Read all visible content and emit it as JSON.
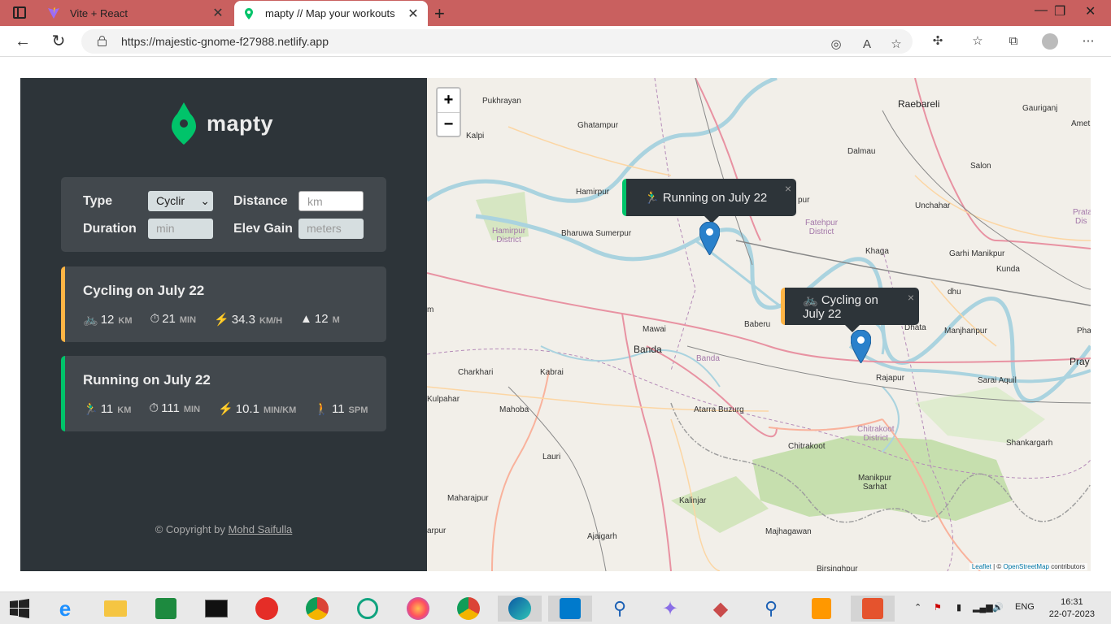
{
  "browser": {
    "tabs": [
      {
        "title": "Vite + React",
        "close": "✕",
        "active": false
      },
      {
        "title": "mapty // Map your workouts",
        "close": "✕",
        "active": true
      }
    ],
    "new_tab": "+",
    "window_controls": {
      "minimize": "—",
      "maximize": "❐",
      "close": "✕"
    },
    "url": "https://majestic-gnome-f27988.netlify.app"
  },
  "sidebar": {
    "logo": "mapty",
    "form": {
      "type_label": "Type",
      "type_value": "Cyclir",
      "distance_label": "Distance",
      "distance_placeholder": "km",
      "duration_label": "Duration",
      "duration_placeholder": "min",
      "elev_label": "Elev Gain",
      "elev_placeholder": "meters"
    },
    "workouts": [
      {
        "title": "Cycling on July 22",
        "color": "#ffb545",
        "details": [
          {
            "icon": "bicycle-icon",
            "glyph": "🚲",
            "value": "12",
            "unit": "KM"
          },
          {
            "icon": "stopwatch-icon",
            "glyph": "⏱",
            "value": "21",
            "unit": "MIN"
          },
          {
            "icon": "lightning-icon",
            "glyph": "⚡",
            "value": "34.3",
            "unit": "KM/H"
          },
          {
            "icon": "mountain-icon",
            "glyph": "▲",
            "value": "12",
            "unit": "M"
          }
        ]
      },
      {
        "title": "Running on July 22",
        "color": "#00c46a",
        "details": [
          {
            "icon": "runner-icon",
            "glyph": "🏃‍♂",
            "value": "11",
            "unit": "KM"
          },
          {
            "icon": "stopwatch-icon",
            "glyph": "⏱",
            "value": "111",
            "unit": "MIN"
          },
          {
            "icon": "lightning-icon",
            "glyph": "⚡",
            "value": "10.1",
            "unit": "MIN/KM"
          },
          {
            "icon": "footsteps-icon",
            "glyph": "🚶",
            "value": "11",
            "unit": "SPM"
          }
        ]
      }
    ],
    "copyright_prefix": "© Copyright by",
    "copyright_author": "Mohd Saifulla"
  },
  "map": {
    "zoom_in": "+",
    "zoom_out": "−",
    "popups": {
      "running": {
        "text": "🏃‍♂ Running on July 22",
        "close": "×"
      },
      "cycling": {
        "text": "🚲 Cycling on July 22",
        "close": "×"
      }
    },
    "attribution_leaflet": "Leaflet",
    "attribution_sep": " | © ",
    "attribution_osm": "OpenStreetMap",
    "attribution_suffix": " contributors",
    "places": {
      "pukhrayan": "Pukhrayan",
      "ghatampur": "Ghatampur",
      "kalpi": "Kalpi",
      "raebareli": "Raebareli",
      "gauriganj": "Gauriganj",
      "amet": "Amet",
      "dalmau": "Dalmau",
      "salon": "Salon",
      "hamirpur": "Hamirpur",
      "pur": "pur",
      "unchahar": "Unchahar",
      "prata": "Prata",
      "dis": "Dis",
      "hamirpur_district": "Hamirpur\nDistrict",
      "bharuwa": "Bharuwa Sumerpur",
      "fatehpur_district": "Fatehpur\nDistrict",
      "khaga": "Khaga",
      "garhi": "Garhi Manikpur",
      "kunda": "Kunda",
      "m": "m",
      "dhu": "dhu",
      "mawai": "Mawai",
      "baberu": "Baberu",
      "dhata": "Dhata",
      "manjhanpur": "Manjhanpur",
      "pha": "Pha",
      "banda": "Banda",
      "banda_district": "Banda",
      "pray": "Pray",
      "charkhari": "Charkhari",
      "kabrai": "Kabrai",
      "rajapur": "Rajapur",
      "sarai": "Sarai Aquil",
      "kulpahar": "Kulpahar",
      "mahoba": "Mahoba",
      "atarra": "Atarra Buzurg",
      "chitrakoot_district": "Chitrakoot\nDistrict",
      "chitrakoot": "Chitrakoot",
      "shankargarh": "Shankargarh",
      "lauri": "Lauri",
      "manikpur": "Manikpur\nSarhat",
      "maharajpur": "Maharajpur",
      "kalinjar": "Kalinjar",
      "arpur": "arpur",
      "ajaigarh": "Ajaigarh",
      "majhagawan": "Majhagawan",
      "birsinghpur": "Birsinghpur"
    }
  },
  "taskbar": {
    "language": "ENG",
    "time": "16:31",
    "date": "22-07-2023"
  }
}
